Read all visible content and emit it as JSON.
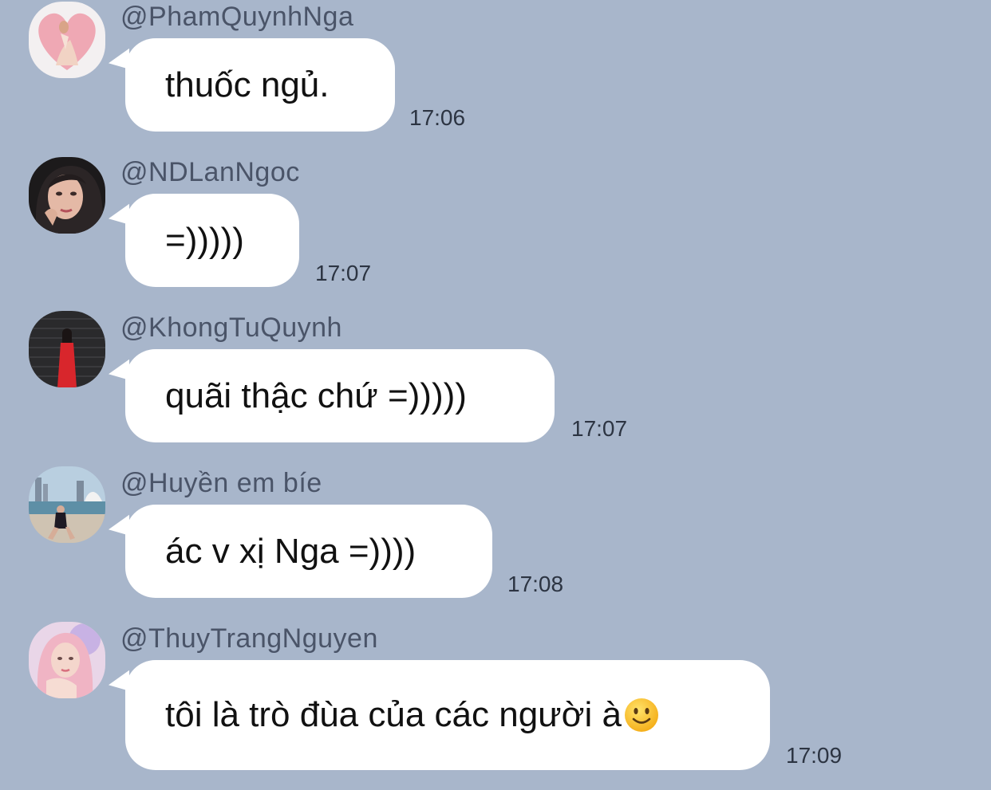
{
  "messages": [
    {
      "username": "@PhamQuynhNga",
      "text": "thuốc ngủ.",
      "time": "17:06",
      "avatar": "avatar-pink-heart"
    },
    {
      "username": "@NDLanNgoc",
      "text": "=)))))",
      "time": "17:07",
      "avatar": "avatar-portrait-dark"
    },
    {
      "username": "@KhongTuQuynh",
      "text": "quãi thậc chứ =)))))",
      "time": "17:07",
      "avatar": "avatar-red-dress"
    },
    {
      "username": "@Huyền em bíe",
      "text": "ác v xị Nga =))))",
      "time": "17:08",
      "avatar": "avatar-harbour"
    },
    {
      "username": "@ThuyTrangNguyen",
      "text": "tôi là trò đùa của các người à",
      "time": "17:09",
      "avatar": "avatar-pink-hair",
      "emoji": "slightly-smiling-face"
    }
  ],
  "colors": {
    "background": "#a8b6cb",
    "bubble": "#ffffff",
    "username": "#4a5468",
    "time": "#2c3442"
  }
}
